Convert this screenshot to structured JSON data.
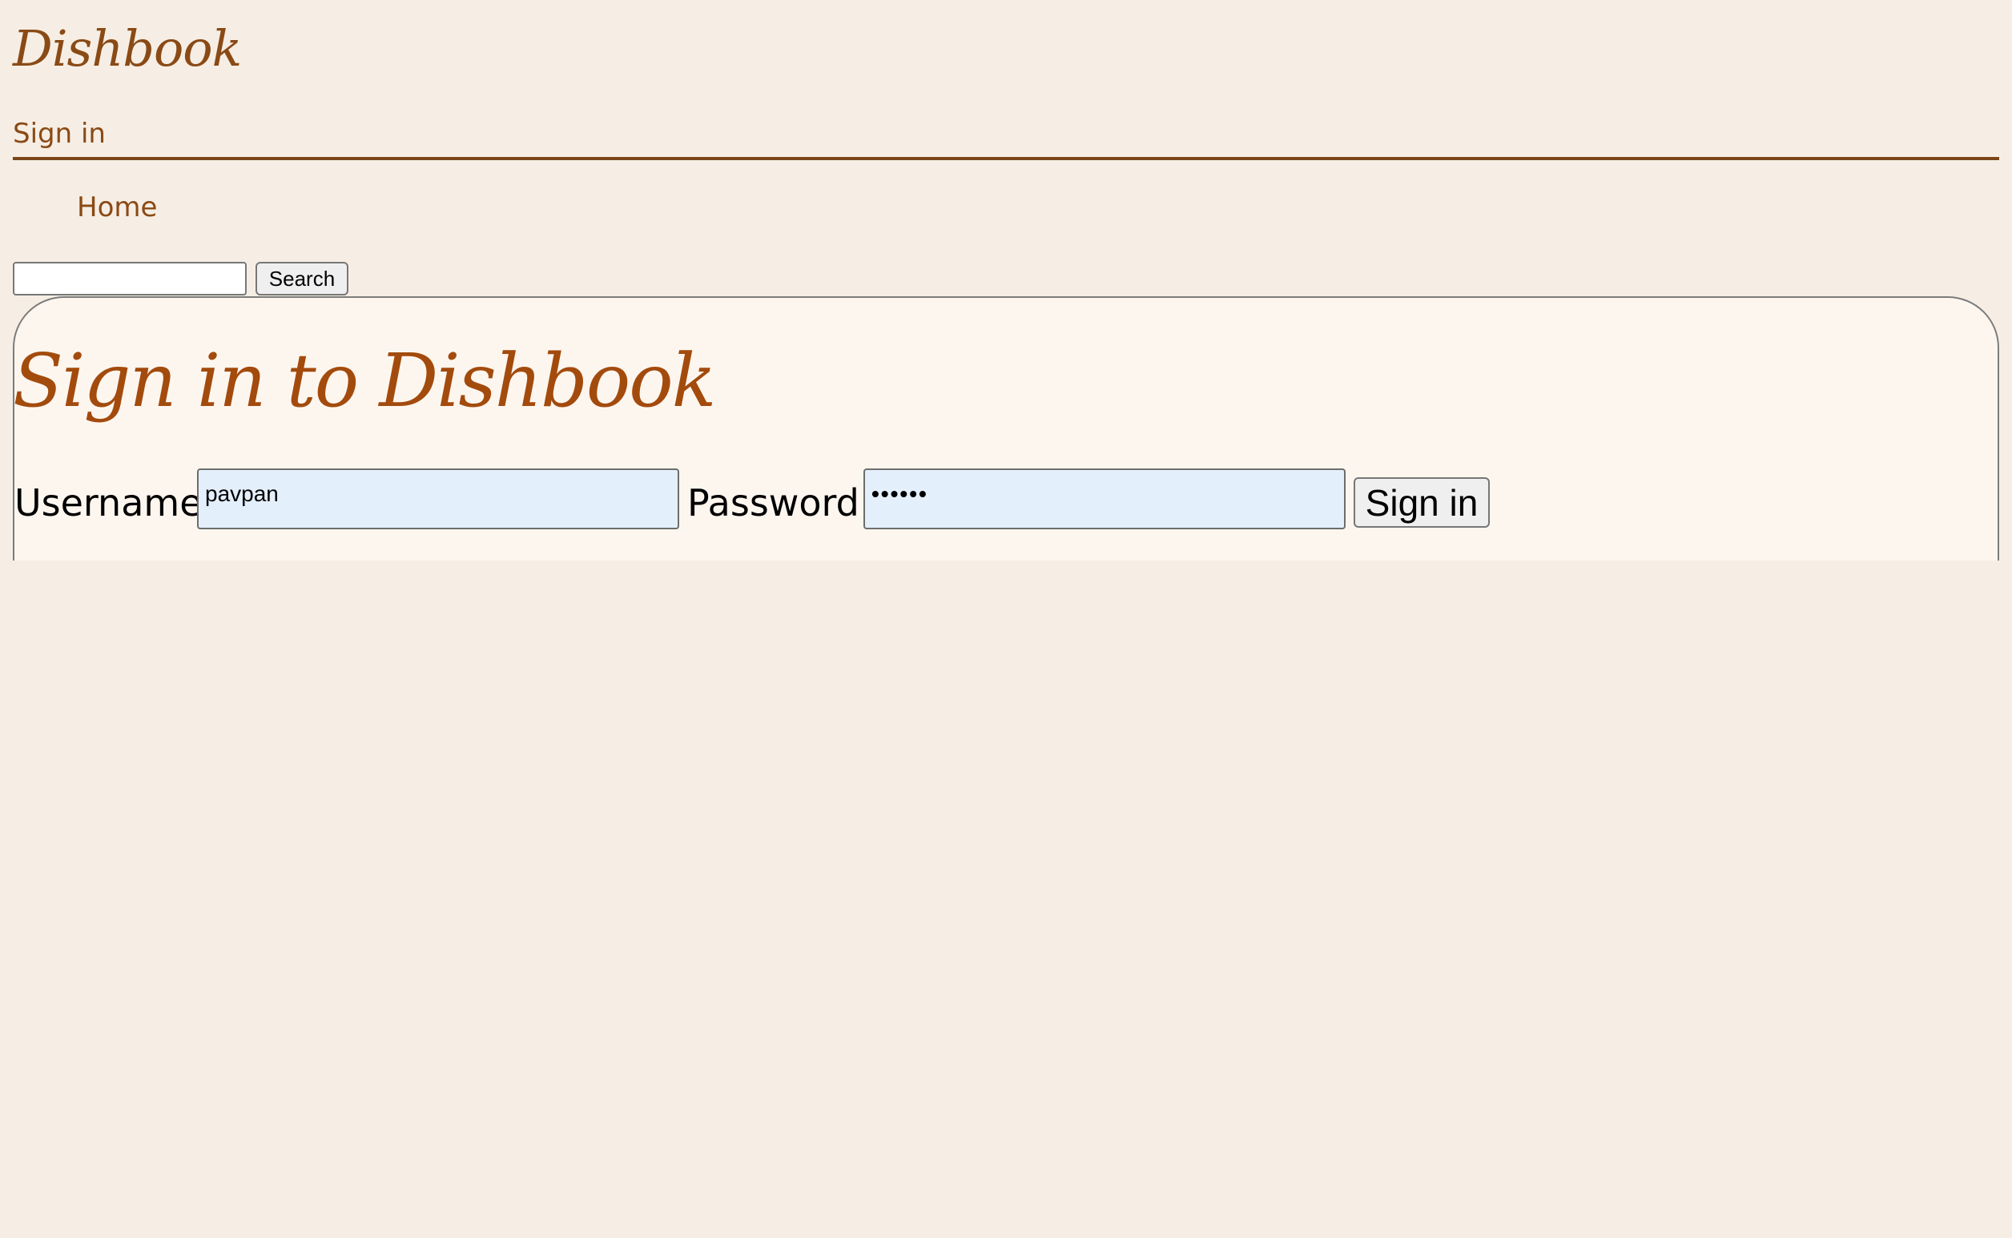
{
  "site": {
    "brand": "Dishbook"
  },
  "header": {
    "signin_link": "Sign in"
  },
  "nav": {
    "home_label": "Home"
  },
  "search": {
    "value": "",
    "placeholder": "",
    "button_label": "Search"
  },
  "login_form": {
    "title": "Sign in to Dishbook",
    "username_label": "Username:",
    "username_value": "pavpan",
    "password_label": "Password:",
    "password_value": "••••••",
    "submit_label": "Sign in"
  },
  "colors": {
    "background": "#f6eee4",
    "panel_background": "#fdf6ef",
    "brand": "#8a4a16",
    "title": "#a34b0d",
    "input_autofill": "#e4effc"
  }
}
